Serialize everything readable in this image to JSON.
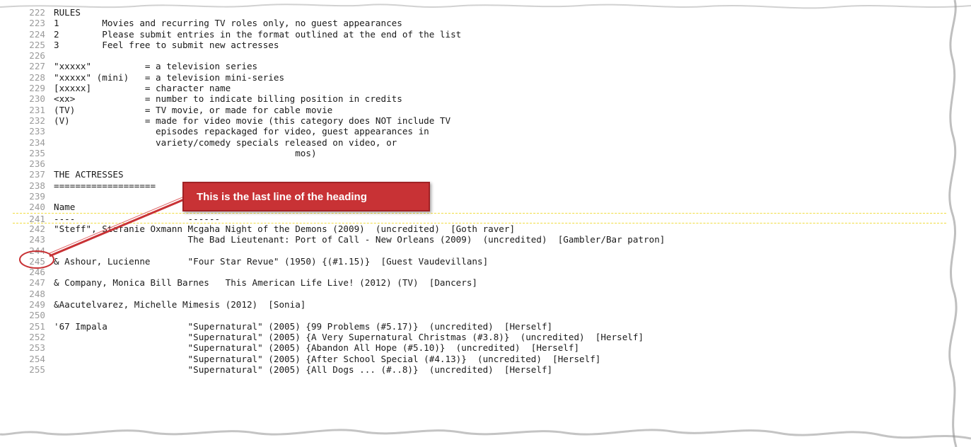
{
  "editor": {
    "lines": [
      {
        "n": "222",
        "t": "RULES"
      },
      {
        "n": "223",
        "t": "1        Movies and recurring TV roles only, no guest appearances"
      },
      {
        "n": "224",
        "t": "2        Please submit entries in the format outlined at the end of the list"
      },
      {
        "n": "225",
        "t": "3        Feel free to submit new actresses"
      },
      {
        "n": "226",
        "t": ""
      },
      {
        "n": "227",
        "t": "\"xxxxx\"          = a television series"
      },
      {
        "n": "228",
        "t": "\"xxxxx\" (mini)   = a television mini-series"
      },
      {
        "n": "229",
        "t": "[xxxxx]          = character name"
      },
      {
        "n": "230",
        "t": "<xx>             = number to indicate billing position in credits"
      },
      {
        "n": "231",
        "t": "(TV)             = TV movie, or made for cable movie"
      },
      {
        "n": "232",
        "t": "(V)              = made for video movie (this category does NOT include TV"
      },
      {
        "n": "233",
        "t": "                   episodes repackaged for video, guest appearances in"
      },
      {
        "n": "234",
        "t": "                   variety/comedy specials released on video, or"
      },
      {
        "n": "235",
        "t": "                                             mos)"
      },
      {
        "n": "236",
        "t": ""
      },
      {
        "n": "237",
        "t": "THE ACTRESSES"
      },
      {
        "n": "238",
        "t": "==================="
      },
      {
        "n": "239",
        "t": ""
      },
      {
        "n": "240",
        "t": "Name                     Titles"
      },
      {
        "n": "241",
        "t": "----                     ------"
      },
      {
        "n": "242",
        "t": "\"Steff\", Stefanie Oxmann Mcgaha Night of the Demons (2009)  (uncredited)  [Goth raver]"
      },
      {
        "n": "243",
        "t": "                         The Bad Lieutenant: Port of Call - New Orleans (2009)  (uncredited)  [Gambler/Bar patron]"
      },
      {
        "n": "244",
        "t": ""
      },
      {
        "n": "245",
        "t": "& Ashour, Lucienne       \"Four Star Revue\" (1950) {(#1.15)}  [Guest Vaudevillans]"
      },
      {
        "n": "246",
        "t": ""
      },
      {
        "n": "247",
        "t": "& Company, Monica Bill Barnes   This American Life Live! (2012) (TV)  [Dancers]"
      },
      {
        "n": "248",
        "t": ""
      },
      {
        "n": "249",
        "t": "&Aacutelvarez, Michelle Mimesis (2012)  [Sonia]"
      },
      {
        "n": "250",
        "t": ""
      },
      {
        "n": "251",
        "t": "'67 Impala               \"Supernatural\" (2005) {99 Problems (#5.17)}  (uncredited)  [Herself]"
      },
      {
        "n": "252",
        "t": "                         \"Supernatural\" (2005) {A Very Supernatural Christmas (#3.8)}  (uncredited)  [Herself]"
      },
      {
        "n": "253",
        "t": "                         \"Supernatural\" (2005) {Abandon All Hope (#5.10)}  (uncredited)  [Herself]"
      },
      {
        "n": "254",
        "t": "                         \"Supernatural\" (2005) {After School Special (#4.13)}  (uncredited)  [Herself]"
      },
      {
        "n": "255",
        "t": "                         \"Supernatural\" (2005) {All Dogs ... (#..8)}  (uncredited)  [Herself]"
      }
    ],
    "highlight_line": "241"
  },
  "callout": {
    "text": "This is the last line of the heading",
    "fill": "#c83235"
  }
}
